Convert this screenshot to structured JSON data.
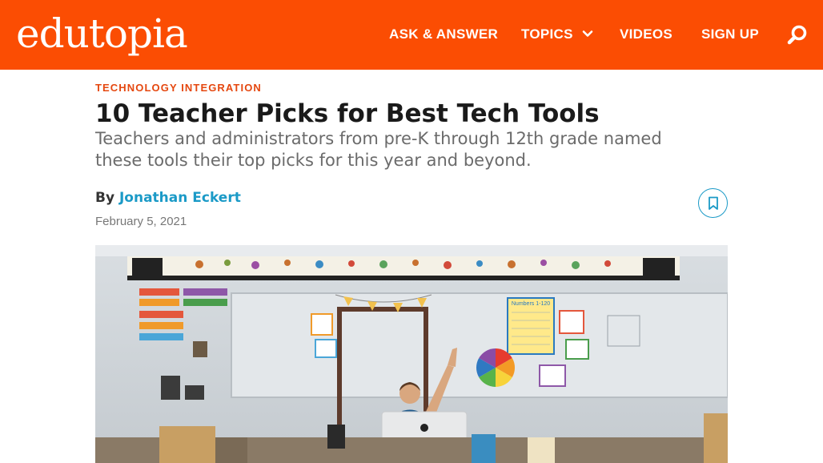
{
  "header": {
    "logo": "edutopia",
    "nav": {
      "ask_answer": "ASK & ANSWER",
      "topics": "TOPICS",
      "videos": "VIDEOS",
      "sign_up": "SIGN UP"
    },
    "brand_color": "#fb4d03"
  },
  "article": {
    "category": "TECHNOLOGY INTEGRATION",
    "title": "10 Teacher Picks for Best Tech Tools",
    "subtitle": "Teachers and administrators from pre-K through 12th grade named these tools their top picks for this year and beyond.",
    "by_label": "By",
    "author": "Jonathan Eckert",
    "date": "February 5, 2021"
  },
  "hero": {
    "chart_poster": "Numbers 1-120"
  },
  "icons": {
    "search": "search-icon",
    "chevron": "chevron-down-icon",
    "bookmark": "bookmark-icon"
  }
}
